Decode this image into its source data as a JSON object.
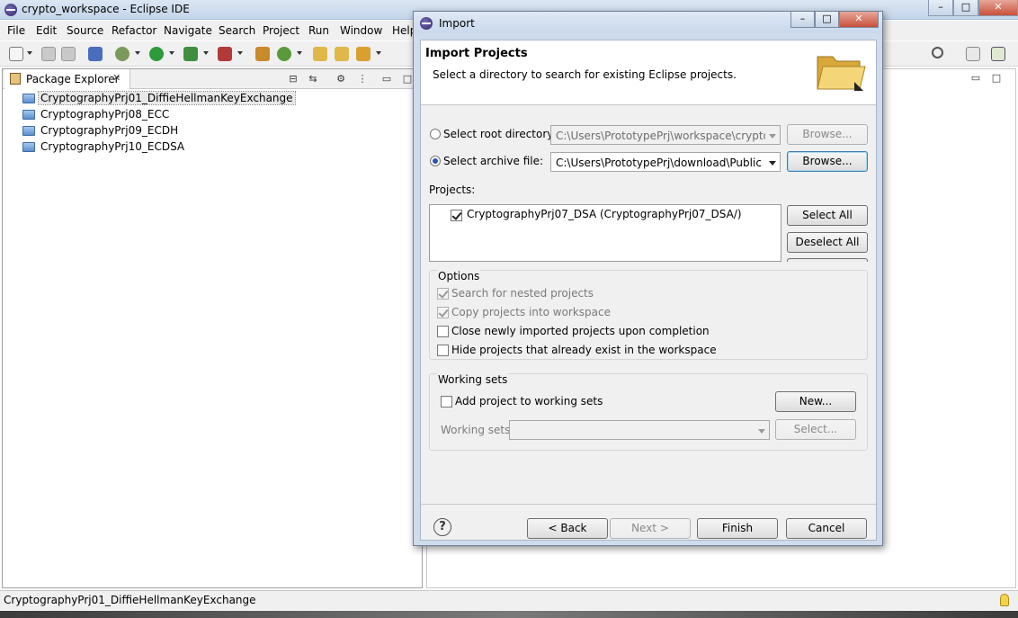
{
  "window": {
    "title": "crypto_workspace - Eclipse IDE",
    "minimize": "–",
    "maximize": "□",
    "close": "✕"
  },
  "menu": [
    "File",
    "Edit",
    "Source",
    "Refactor",
    "Navigate",
    "Search",
    "Project",
    "Run",
    "Window",
    "Help"
  ],
  "package_explorer": {
    "tab_label": "Package Explorer",
    "tab_close": "✕",
    "items": [
      "CryptographyPrj01_DiffieHellmanKeyExchange",
      "CryptographyPrj08_ECC",
      "CryptographyPrj09_ECDH",
      "CryptographyPrj10_ECDSA"
    ]
  },
  "status_bar": {
    "text": "CryptographyPrj01_DiffieHellmanKeyExchange"
  },
  "dialog": {
    "title": "Import",
    "minimize": "–",
    "maximize": "□",
    "close": "✕",
    "heading": "Import Projects",
    "subheading": "Select a directory to search for existing Eclipse projects.",
    "root_dir_label": "Select root directory:",
    "root_dir_value": "C:\\Users\\PrototypePrj\\workspace\\crypto_wo",
    "archive_label": "Select archive file:",
    "archive_value": "C:\\Users\\PrototypePrj\\download\\Public Key",
    "browse": "Browse...",
    "projects_label": "Projects:",
    "project_items": [
      "CryptographyPrj07_DSA (CryptographyPrj07_DSA/)"
    ],
    "select_all": "Select All",
    "deselect_all": "Deselect All",
    "options_title": "Options",
    "options": [
      {
        "label": "Search for nested projects",
        "checked": true,
        "enabled": false
      },
      {
        "label": "Copy projects into workspace",
        "checked": true,
        "enabled": false
      },
      {
        "label": "Close newly imported projects upon completion",
        "checked": false,
        "enabled": true
      },
      {
        "label": "Hide projects that already exist in the workspace",
        "checked": false,
        "enabled": true
      }
    ],
    "working_sets_title": "Working sets",
    "add_to_working_sets": "Add project to working sets",
    "new_button": "New...",
    "working_sets_label": "Working sets:",
    "select_button": "Select...",
    "help": "?",
    "back": "< Back",
    "next": "Next >",
    "finish": "Finish",
    "cancel": "Cancel"
  }
}
